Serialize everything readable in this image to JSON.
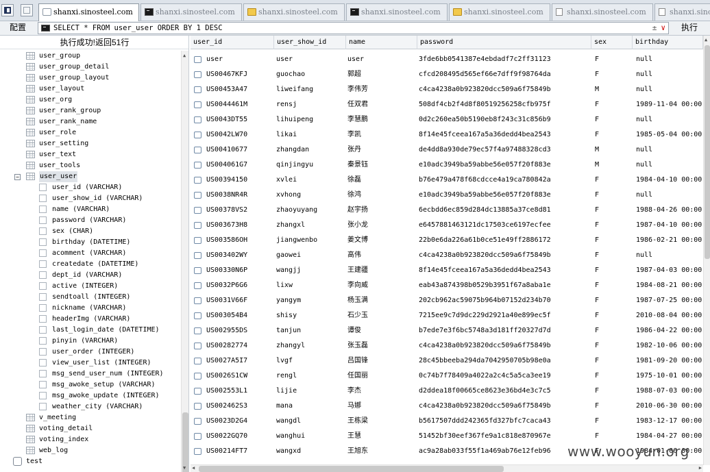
{
  "tabs": [
    {
      "label": "shanxi.sinosteel.com",
      "icon": "page-icon",
      "active": true
    },
    {
      "label": "shanxi.sinosteel.com",
      "icon": "terminal-icon",
      "active": false
    },
    {
      "label": "shanxi.sinosteel.com",
      "icon": "folder-icon",
      "active": false
    },
    {
      "label": "shanxi.sinosteel.com",
      "icon": "terminal-icon",
      "active": false
    },
    {
      "label": "shanxi.sinosteel.com",
      "icon": "folder-icon",
      "active": false
    },
    {
      "label": "shanxi.sinosteel.com",
      "icon": "document-icon",
      "active": false
    },
    {
      "label": "shanxi.sinosteel.com",
      "icon": "document-icon",
      "active": false
    }
  ],
  "query": {
    "config_label": "配置",
    "sql": "SELECT * FROM user_user ORDER BY 1 DESC",
    "ops": "±",
    "dropdown": "∨",
    "run_label": "执行"
  },
  "status": "执行成功!返回51行",
  "tree": {
    "tables_before": [
      "user_group",
      "user_group_detail",
      "user_group_layout",
      "user_layout",
      "user_org",
      "user_rank_group",
      "user_rank_name",
      "user_role",
      "user_setting",
      "user_text",
      "user_tools"
    ],
    "selected_table": "user_user",
    "columns": [
      "user_id (VARCHAR)",
      "user_show_id (VARCHAR)",
      "name (VARCHAR)",
      "password (VARCHAR)",
      "sex (CHAR)",
      "birthday (DATETIME)",
      "acomment (VARCHAR)",
      "createdate (DATETIME)",
      "dept_id (VARCHAR)",
      "active (INTEGER)",
      "sendtoall (INTEGER)",
      "nickname (VARCHAR)",
      "headerImg (VARCHAR)",
      "last_login_date (DATETIME)",
      "pinyin (VARCHAR)",
      "user_order (INTEGER)",
      "view_user_list (INTEGER)",
      "msg_send_user_num (INTEGER)",
      "msg_awoke_setup (VARCHAR)",
      "msg_awoke_update (INTEGER)",
      "weather_city (VARCHAR)"
    ],
    "tables_after": [
      "v_meeting",
      "voting_detail",
      "voting_index",
      "web_log"
    ],
    "database": "test",
    "expand_symbol": "−"
  },
  "grid": {
    "columns": [
      "user_id",
      "user_show_id",
      "name",
      "password",
      "sex",
      "birthday"
    ],
    "rows": [
      [
        "user",
        "user",
        "user",
        "3fde6bb0541387e4ebdadf7c2ff31123",
        "F",
        "null"
      ],
      [
        "US00467KFJ",
        "guochao",
        "郭超",
        "cfcd208495d565ef66e7dff9f98764da",
        "F",
        "null"
      ],
      [
        "US00453A47",
        "liweifang",
        "李伟芳",
        "c4ca4238a0b923820dcc509a6f75849b",
        "M",
        "null"
      ],
      [
        "US0044461M",
        "rensj",
        "任双君",
        "508df4cb2f4d8f80519256258cfb975f",
        "F",
        "1989-11-04 00:00"
      ],
      [
        "US0043DT55",
        "lihuipeng",
        "李慧鹏",
        "0d2c260ea50b5190eb8f243c31c856b9",
        "F",
        "null"
      ],
      [
        "US0042LW70",
        "likai",
        "李凯",
        "8f14e45fceea167a5a36dedd4bea2543",
        "F",
        "1985-05-04 00:00"
      ],
      [
        "US00410677",
        "zhangdan",
        "张丹",
        "de4dd8a930de79ec57f4a97488328cd3",
        "M",
        "null"
      ],
      [
        "US004061G7",
        "qinjingyu",
        "秦景钰",
        "e10adc3949ba59abbe56e057f20f883e",
        "M",
        "null"
      ],
      [
        "US00394150",
        "xvlei",
        "徐磊",
        "b76e479a478f68cdcce4a19ca780842a",
        "F",
        "1984-04-10 00:00"
      ],
      [
        "US0038NR4R",
        "xvhong",
        "徐鸿",
        "e10adc3949ba59abbe56e057f20f883e",
        "F",
        "null"
      ],
      [
        "US00378VS2",
        "zhaoyuyang",
        "赵宇扬",
        "6ecbdd6ec859d284dc13885a37ce8d81",
        "F",
        "1988-04-26 00:00"
      ],
      [
        "US003673H8",
        "zhangxl",
        "张小龙",
        "e6457881463121dc17503ce6197ecfee",
        "F",
        "1987-04-10 00:00"
      ],
      [
        "US003586OH",
        "jiangwenbo",
        "姜文博",
        "22b0e6da226a61b0ce51e49ff2886172",
        "F",
        "1986-02-21 00:00"
      ],
      [
        "US003402WY",
        "gaowei",
        "高伟",
        "c4ca4238a0b923820dcc509a6f75849b",
        "F",
        "null"
      ],
      [
        "US00330N6P",
        "wangjj",
        "王建疆",
        "8f14e45fceea167a5a36dedd4bea2543",
        "F",
        "1987-04-03 00:00"
      ],
      [
        "US0032P6G6",
        "lixw",
        "李向威",
        "eab43a874398b0529b3951f67a8aba1e",
        "F",
        "1984-08-21 00:00"
      ],
      [
        "US0031V66F",
        "yangym",
        "杨玉满",
        "202cb962ac59075b964b07152d234b70",
        "F",
        "1987-07-25 00:00"
      ],
      [
        "US003054B4",
        "shisy",
        "石少玉",
        "7215ee9c7d9dc229d2921a40e899ec5f",
        "F",
        "2010-08-04 00:00"
      ],
      [
        "US002955DS",
        "tanjun",
        "谭俊",
        "b7ede7e3f6bc5748a3d181ff20327d7d",
        "F",
        "1986-04-22 00:00"
      ],
      [
        "US00282774",
        "zhangyl",
        "张玉磊",
        "c4ca4238a0b923820dcc509a6f75849b",
        "F",
        "1982-10-06 00:00"
      ],
      [
        "US0027A5I7",
        "lvgf",
        "吕国锋",
        "28c45bbeeba294da7042950705b98e0a",
        "F",
        "1981-09-20 00:00"
      ],
      [
        "US0026S1CW",
        "rengl",
        "任国丽",
        "0c74b7f78409a4022a2c4c5a5ca3ee19",
        "F",
        "1975-10-01 00:00"
      ],
      [
        "US002553L1",
        "lijie",
        "李杰",
        "d2ddea18f00665ce8623e36bd4e3c7c5",
        "F",
        "1988-07-03 00:00"
      ],
      [
        "US002462S3",
        "mana",
        "马娜",
        "c4ca4238a0b923820dcc509a6f75849b",
        "F",
        "2010-06-30 00:00"
      ],
      [
        "US0023D2G4",
        "wangdl",
        "王栋梁",
        "b5617507ddd242365fd327bfc7caca43",
        "F",
        "1983-12-17 00:00"
      ],
      [
        "US0022GQ70",
        "wanghui",
        "王慧",
        "51452bf30eef367fe9a1c818e870967e",
        "F",
        "1984-04-27 00:00"
      ],
      [
        "US00214FT7",
        "wangxd",
        "王旭东",
        "ac9a28ab033f55f1a469ab76e12feb96",
        "F",
        "1984-01-06 00:00"
      ]
    ]
  },
  "watermark": "www.wooyun.org"
}
